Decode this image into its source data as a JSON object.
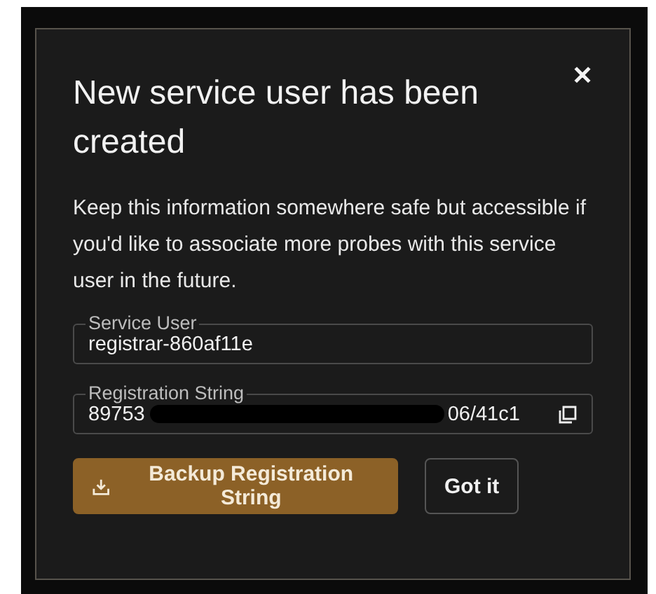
{
  "dialog": {
    "title": "New service user has been created",
    "close": "✕",
    "message": "Keep this information somewhere safe but accessible if you'd like to associate more probes with this service user in the future.",
    "fields": [
      {
        "label": "Service User",
        "value": "registrar-860af11e",
        "redacted": false
      },
      {
        "label": "Registration String",
        "value_start": "89753",
        "value_end": "06/41c1",
        "redacted": true,
        "copyable": true
      }
    ],
    "buttons": [
      {
        "kind": "primary",
        "label": "Backup Registration String"
      },
      {
        "kind": "secondary",
        "label": "Got it"
      }
    ]
  }
}
